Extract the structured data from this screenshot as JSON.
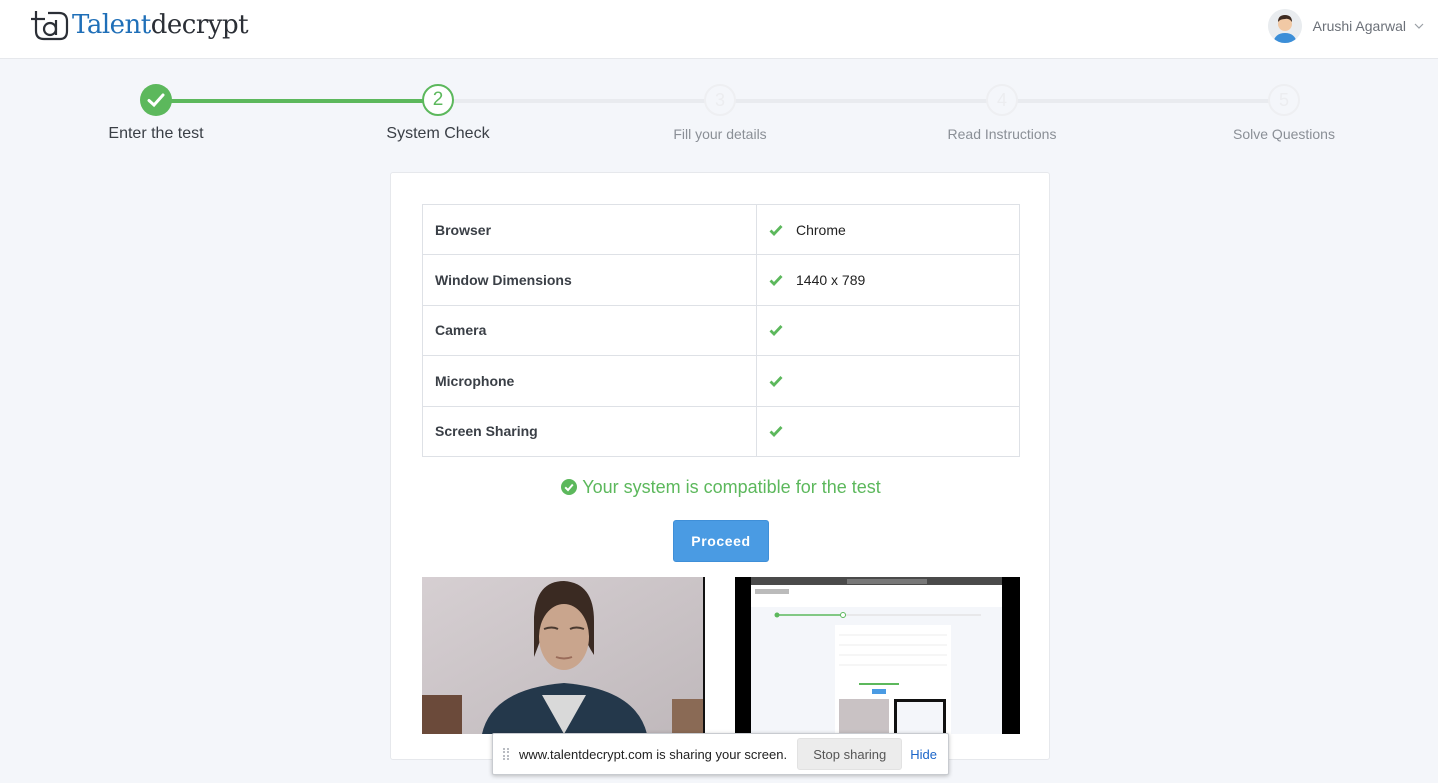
{
  "header": {
    "logo": {
      "prefix": "Talent",
      "suffix": "decrypt"
    },
    "user": {
      "name": "Arushi Agarwal"
    }
  },
  "stepper": {
    "steps": [
      {
        "number": "1",
        "label": "Enter the test",
        "state": "done"
      },
      {
        "number": "2",
        "label": "System Check",
        "state": "active"
      },
      {
        "number": "3",
        "label": "Fill your details",
        "state": "todo"
      },
      {
        "number": "4",
        "label": "Read Instructions",
        "state": "todo"
      },
      {
        "number": "5",
        "label": "Solve Questions",
        "state": "todo"
      }
    ]
  },
  "checks": {
    "rows": [
      {
        "label": "Browser",
        "value": "Chrome",
        "status": "pass"
      },
      {
        "label": "Window Dimensions",
        "value": "1440 x 789",
        "status": "pass"
      },
      {
        "label": "Camera",
        "value": "",
        "status": "pass"
      },
      {
        "label": "Microphone",
        "value": "",
        "status": "pass"
      },
      {
        "label": "Screen Sharing",
        "value": "",
        "status": "pass"
      }
    ],
    "result_message": "Your system is compatible for the test",
    "proceed_label": "Proceed"
  },
  "share_bar": {
    "message": "www.talentdecrypt.com is sharing your screen.",
    "stop_label": "Stop sharing",
    "hide_label": "Hide"
  },
  "colors": {
    "success": "#5cb85c",
    "primary": "#4a9be3",
    "link": "#1a65c9"
  }
}
